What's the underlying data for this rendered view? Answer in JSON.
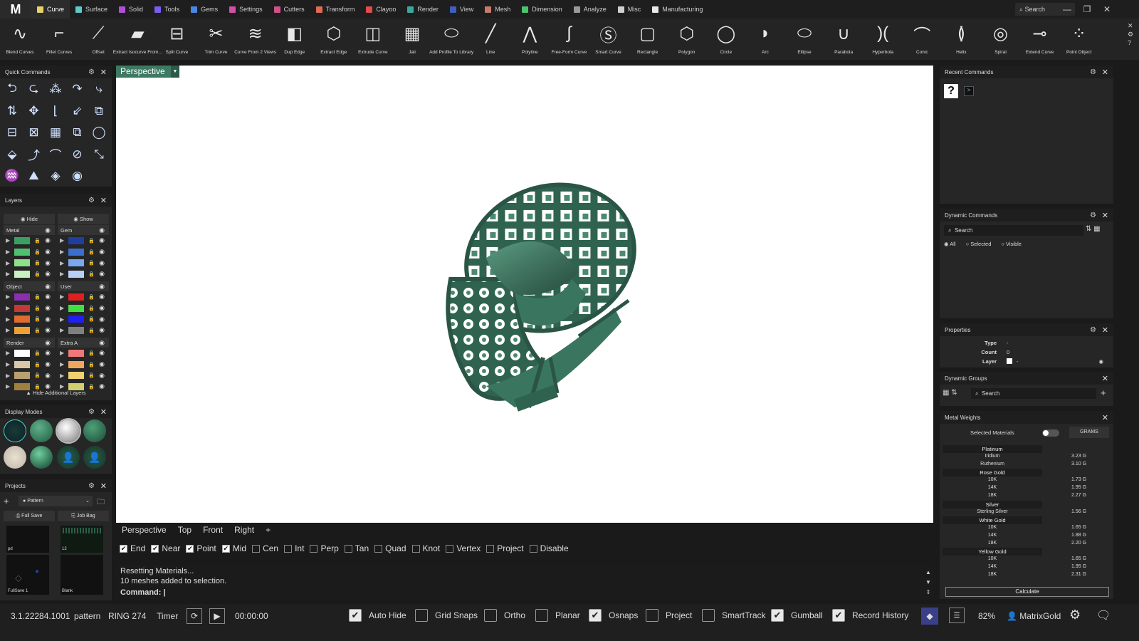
{
  "app": {
    "logo": "M"
  },
  "tabs": [
    {
      "label": "Curve",
      "color": "#e6d26a"
    },
    {
      "label": "Surface",
      "color": "#5fc9c9"
    },
    {
      "label": "Solid",
      "color": "#b04fd6"
    },
    {
      "label": "Tools",
      "color": "#7a5cf0"
    },
    {
      "label": "Gems",
      "color": "#4a86e8"
    },
    {
      "label": "Settings",
      "color": "#d24fa6"
    },
    {
      "label": "Cutters",
      "color": "#d24f8a"
    },
    {
      "label": "Transform",
      "color": "#e06b55"
    },
    {
      "label": "Clayoo",
      "color": "#e04b4b"
    },
    {
      "label": "Render",
      "color": "#3aa89c"
    },
    {
      "label": "View",
      "color": "#3f5fbf"
    },
    {
      "label": "Mesh",
      "color": "#c87a6a"
    },
    {
      "label": "Dimension",
      "color": "#4ac46a"
    },
    {
      "label": "Analyze",
      "color": "#999999"
    },
    {
      "label": "Misc",
      "color": "#cfcfcf"
    },
    {
      "label": "Manufacturing",
      "color": "#e8e8e8"
    }
  ],
  "top_search": "Search",
  "ribbon": [
    {
      "label": "Blend Curves",
      "icon": "blend-curves-icon",
      "glyph": "∿"
    },
    {
      "label": "Fillet Curves",
      "icon": "fillet-curves-icon",
      "glyph": "⌐"
    },
    {
      "label": "Offset",
      "icon": "offset-icon",
      "glyph": "⟋"
    },
    {
      "label": "Extract Isocurve From...",
      "icon": "extract-isocurve-icon",
      "glyph": "▰"
    },
    {
      "label": "Split Curve",
      "icon": "split-curve-icon",
      "glyph": "⊟"
    },
    {
      "label": "Trim Curve",
      "icon": "trim-curve-icon",
      "glyph": "✂"
    },
    {
      "label": "Curve From 2 Views",
      "icon": "curve-2views-icon",
      "glyph": "≋"
    },
    {
      "label": "Dup Edge",
      "icon": "dup-edge-icon",
      "glyph": "◧"
    },
    {
      "label": "Extract Edge",
      "icon": "extract-edge-icon",
      "glyph": "⬡"
    },
    {
      "label": "Extrude Curve",
      "icon": "extrude-curve-icon",
      "glyph": "◫"
    },
    {
      "label": "Jali",
      "icon": "jali-icon",
      "glyph": "▦"
    },
    {
      "label": "Add Profile To Library",
      "icon": "add-profile-icon",
      "glyph": "⬭"
    },
    {
      "label": "Line",
      "icon": "line-icon",
      "glyph": "╱"
    },
    {
      "label": "Polyline",
      "icon": "polyline-icon",
      "glyph": "⋀"
    },
    {
      "label": "Free-Form Curve",
      "icon": "freeform-curve-icon",
      "glyph": "∫"
    },
    {
      "label": "Smart Curve",
      "icon": "smart-curve-icon",
      "glyph": "Ⓢ"
    },
    {
      "label": "Rectangle",
      "icon": "rectangle-icon",
      "glyph": "▢"
    },
    {
      "label": "Polygon",
      "icon": "polygon-icon",
      "glyph": "⬡"
    },
    {
      "label": "Circle",
      "icon": "circle-icon",
      "glyph": "◯"
    },
    {
      "label": "Arc",
      "icon": "arc-icon",
      "glyph": "◗"
    },
    {
      "label": "Ellipse",
      "icon": "ellipse-icon",
      "glyph": "⬭"
    },
    {
      "label": "Parabola",
      "icon": "parabola-icon",
      "glyph": "∪"
    },
    {
      "label": "Hyperbola",
      "icon": "hyperbola-icon",
      "glyph": ")("
    },
    {
      "label": "Conic",
      "icon": "conic-icon",
      "glyph": "⌒"
    },
    {
      "label": "Helix",
      "icon": "helix-icon",
      "glyph": "≬"
    },
    {
      "label": "Spiral",
      "icon": "spiral-icon",
      "glyph": "◎"
    },
    {
      "label": "Extend Curve",
      "icon": "extend-curve-icon",
      "glyph": "⊸"
    },
    {
      "label": "Point Object",
      "icon": "point-object-icon",
      "glyph": "⁘"
    }
  ],
  "panels": {
    "quick_commands": "Quick Commands",
    "layers": "Layers",
    "display_modes": "Display Modes",
    "projects": "Projects",
    "recent_commands": "Recent Commands",
    "dynamic_commands": "Dynamic Commands",
    "properties": "Properties",
    "dynamic_groups": "Dynamic Groups",
    "metal_weights": "Metal Weights"
  },
  "layers": {
    "hide": "Hide",
    "show": "Show",
    "hide_additional": "Hide Additional Layers",
    "groups": [
      {
        "name": "Metal",
        "colors": [
          "#3aa060",
          "#4fbf70",
          "#8fe08a",
          "#c8f0c0"
        ]
      },
      {
        "name": "Gem",
        "colors": [
          "#1f3fa0",
          "#3a6fd0",
          "#7aa8f0",
          "#b8d0f8"
        ]
      },
      {
        "name": "Object",
        "colors": [
          "#8a2fb0",
          "#c03a3a",
          "#e06a30",
          "#f0a030"
        ]
      },
      {
        "name": "User",
        "colors": [
          "#e02020",
          "#40e040",
          "#2020f0",
          "#808080"
        ]
      },
      {
        "name": "Render",
        "colors": [
          "#ffffff",
          "#d8c8a8",
          "#b8a070",
          "#a08040"
        ]
      },
      {
        "name": "Extra A",
        "colors": [
          "#f07878",
          "#f0a860",
          "#f0d070",
          "#d0d070"
        ]
      }
    ]
  },
  "projects": {
    "select": "Pattern",
    "full_save": "Full Save",
    "job_bag": "Job Bag",
    "thumbs": [
      "pd",
      "12",
      "FullSave 1",
      "Blank"
    ]
  },
  "viewport": {
    "active": "Perspective",
    "tabs": [
      "Perspective",
      "Top",
      "Front",
      "Right"
    ],
    "add": "+"
  },
  "snaps": [
    {
      "label": "End",
      "on": true
    },
    {
      "label": "Near",
      "on": true
    },
    {
      "label": "Point",
      "on": true
    },
    {
      "label": "Mid",
      "on": true
    },
    {
      "label": "Cen",
      "on": false
    },
    {
      "label": "Int",
      "on": false
    },
    {
      "label": "Perp",
      "on": false
    },
    {
      "label": "Tan",
      "on": false
    },
    {
      "label": "Quad",
      "on": false
    },
    {
      "label": "Knot",
      "on": false
    },
    {
      "label": "Vertex",
      "on": false
    },
    {
      "label": "Project",
      "on": false
    },
    {
      "label": "Disable",
      "on": false
    }
  ],
  "command": {
    "line1": "Resetting Materials...",
    "line2": "10 meshes added to selection.",
    "prompt": "Command:"
  },
  "status": {
    "version": "3.1.22284.1001",
    "project": "pattern",
    "model": "RING 274",
    "timer": "Timer",
    "time": "00:00:00",
    "toggles": [
      {
        "label": "Auto Hide",
        "on": true
      },
      {
        "label": "Grid Snaps",
        "on": false
      },
      {
        "label": "Ortho",
        "on": false
      },
      {
        "label": "Planar",
        "on": false
      },
      {
        "label": "Osnaps",
        "on": true
      },
      {
        "label": "Project",
        "on": false
      },
      {
        "label": "SmartTrack",
        "on": false
      },
      {
        "label": "Gumball",
        "on": true
      },
      {
        "label": "Record History",
        "on": true
      }
    ],
    "zoom": "82%",
    "user": "MatrixGold"
  },
  "dynamic_commands": {
    "search": "Search",
    "filters": [
      {
        "label": "All",
        "on": true
      },
      {
        "label": "Selected",
        "on": false
      },
      {
        "label": "Visible",
        "on": false
      }
    ]
  },
  "properties": {
    "type_label": "Type",
    "type_value": "-",
    "count_label": "Count",
    "count_value": "0",
    "layer_label": "Layer",
    "layer_value": "-"
  },
  "dynamic_groups": {
    "search": "Search"
  },
  "metal_weights": {
    "selected_materials": "Selected Materials",
    "unit": "GRAMS",
    "calculate": "Calculate",
    "groups": [
      {
        "name": "Platinum",
        "rows": [
          {
            "k": "Iridium",
            "v": "3.23 G"
          },
          {
            "k": "Ruthenium",
            "v": "3.10 G"
          }
        ]
      },
      {
        "name": "Rose Gold",
        "rows": [
          {
            "k": "10K",
            "v": "1.73 G"
          },
          {
            "k": "14K",
            "v": "1.95 G"
          },
          {
            "k": "18K",
            "v": "2.27 G"
          }
        ]
      },
      {
        "name": "Silver",
        "rows": [
          {
            "k": "Sterling Silver",
            "v": "1.56 G"
          }
        ]
      },
      {
        "name": "White Gold",
        "rows": [
          {
            "k": "10K",
            "v": "1.65 G"
          },
          {
            "k": "14K",
            "v": "1.88 G"
          },
          {
            "k": "18K",
            "v": "2.20 G"
          }
        ]
      },
      {
        "name": "Yellow Gold",
        "rows": [
          {
            "k": "10K",
            "v": "1.65 G"
          },
          {
            "k": "14K",
            "v": "1.95 G"
          },
          {
            "k": "18K",
            "v": "2.31 G"
          }
        ]
      }
    ]
  },
  "colors": {
    "accent": "#3e7a62",
    "ring": "#3f7a62"
  }
}
